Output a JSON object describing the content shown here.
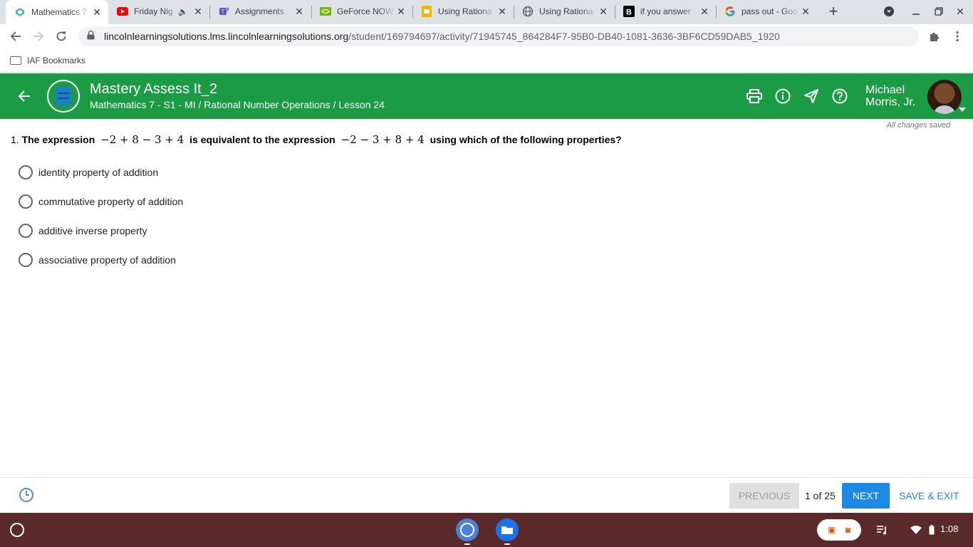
{
  "browser": {
    "tabs": [
      {
        "title": "Mathematics 7",
        "favicon": "lincoln-learning-icon",
        "active": true
      },
      {
        "title": "Friday Nig",
        "favicon": "youtube-icon",
        "audio": true
      },
      {
        "title": "Assignments",
        "favicon": "teams-icon"
      },
      {
        "title": "GeForce NOW",
        "favicon": "nvidia-icon"
      },
      {
        "title": "Using Rationa",
        "favicon": "slides-icon"
      },
      {
        "title": "Using Rationa",
        "favicon": "globe-icon"
      },
      {
        "title": "if you answer",
        "favicon": "brainly-icon"
      },
      {
        "title": "pass out - Goo",
        "favicon": "google-icon"
      }
    ],
    "url_host": "lincolnlearningsolutions.lms.lincolnlearningsolutions.org",
    "url_path": "/student/169794697/activity/71945745_864284F7-95B0-DB40-1081-3636-3BF6CD59DAB5_1920",
    "bookmark_folder": "IAF Bookmarks"
  },
  "app": {
    "title": "Mastery Assess It_2",
    "breadcrumb": "Mathematics 7 - S1 - MI / Rational Number Operations / Lesson 24",
    "user_first": "Michael",
    "user_last": "Morris, Jr.",
    "status": "All changes saved",
    "brand_color": "#1a9b44"
  },
  "question": {
    "number": "1.",
    "text_a": "The expression",
    "expr_1": "−2 + 8 − 3 + 4",
    "text_b": "is equivalent to the expression",
    "expr_2": "−2 − 3 + 8 + 4",
    "text_c": "using which of the following properties?",
    "options": [
      "identity property of addition",
      "commutative property of addition",
      "additive inverse property",
      "associative property of addition"
    ]
  },
  "footer": {
    "previous_label": "PREVIOUS",
    "pager": "1 of 25",
    "next_label": "NEXT",
    "save_exit_label": "SAVE & EXIT"
  },
  "shelf": {
    "time": "1:08"
  }
}
